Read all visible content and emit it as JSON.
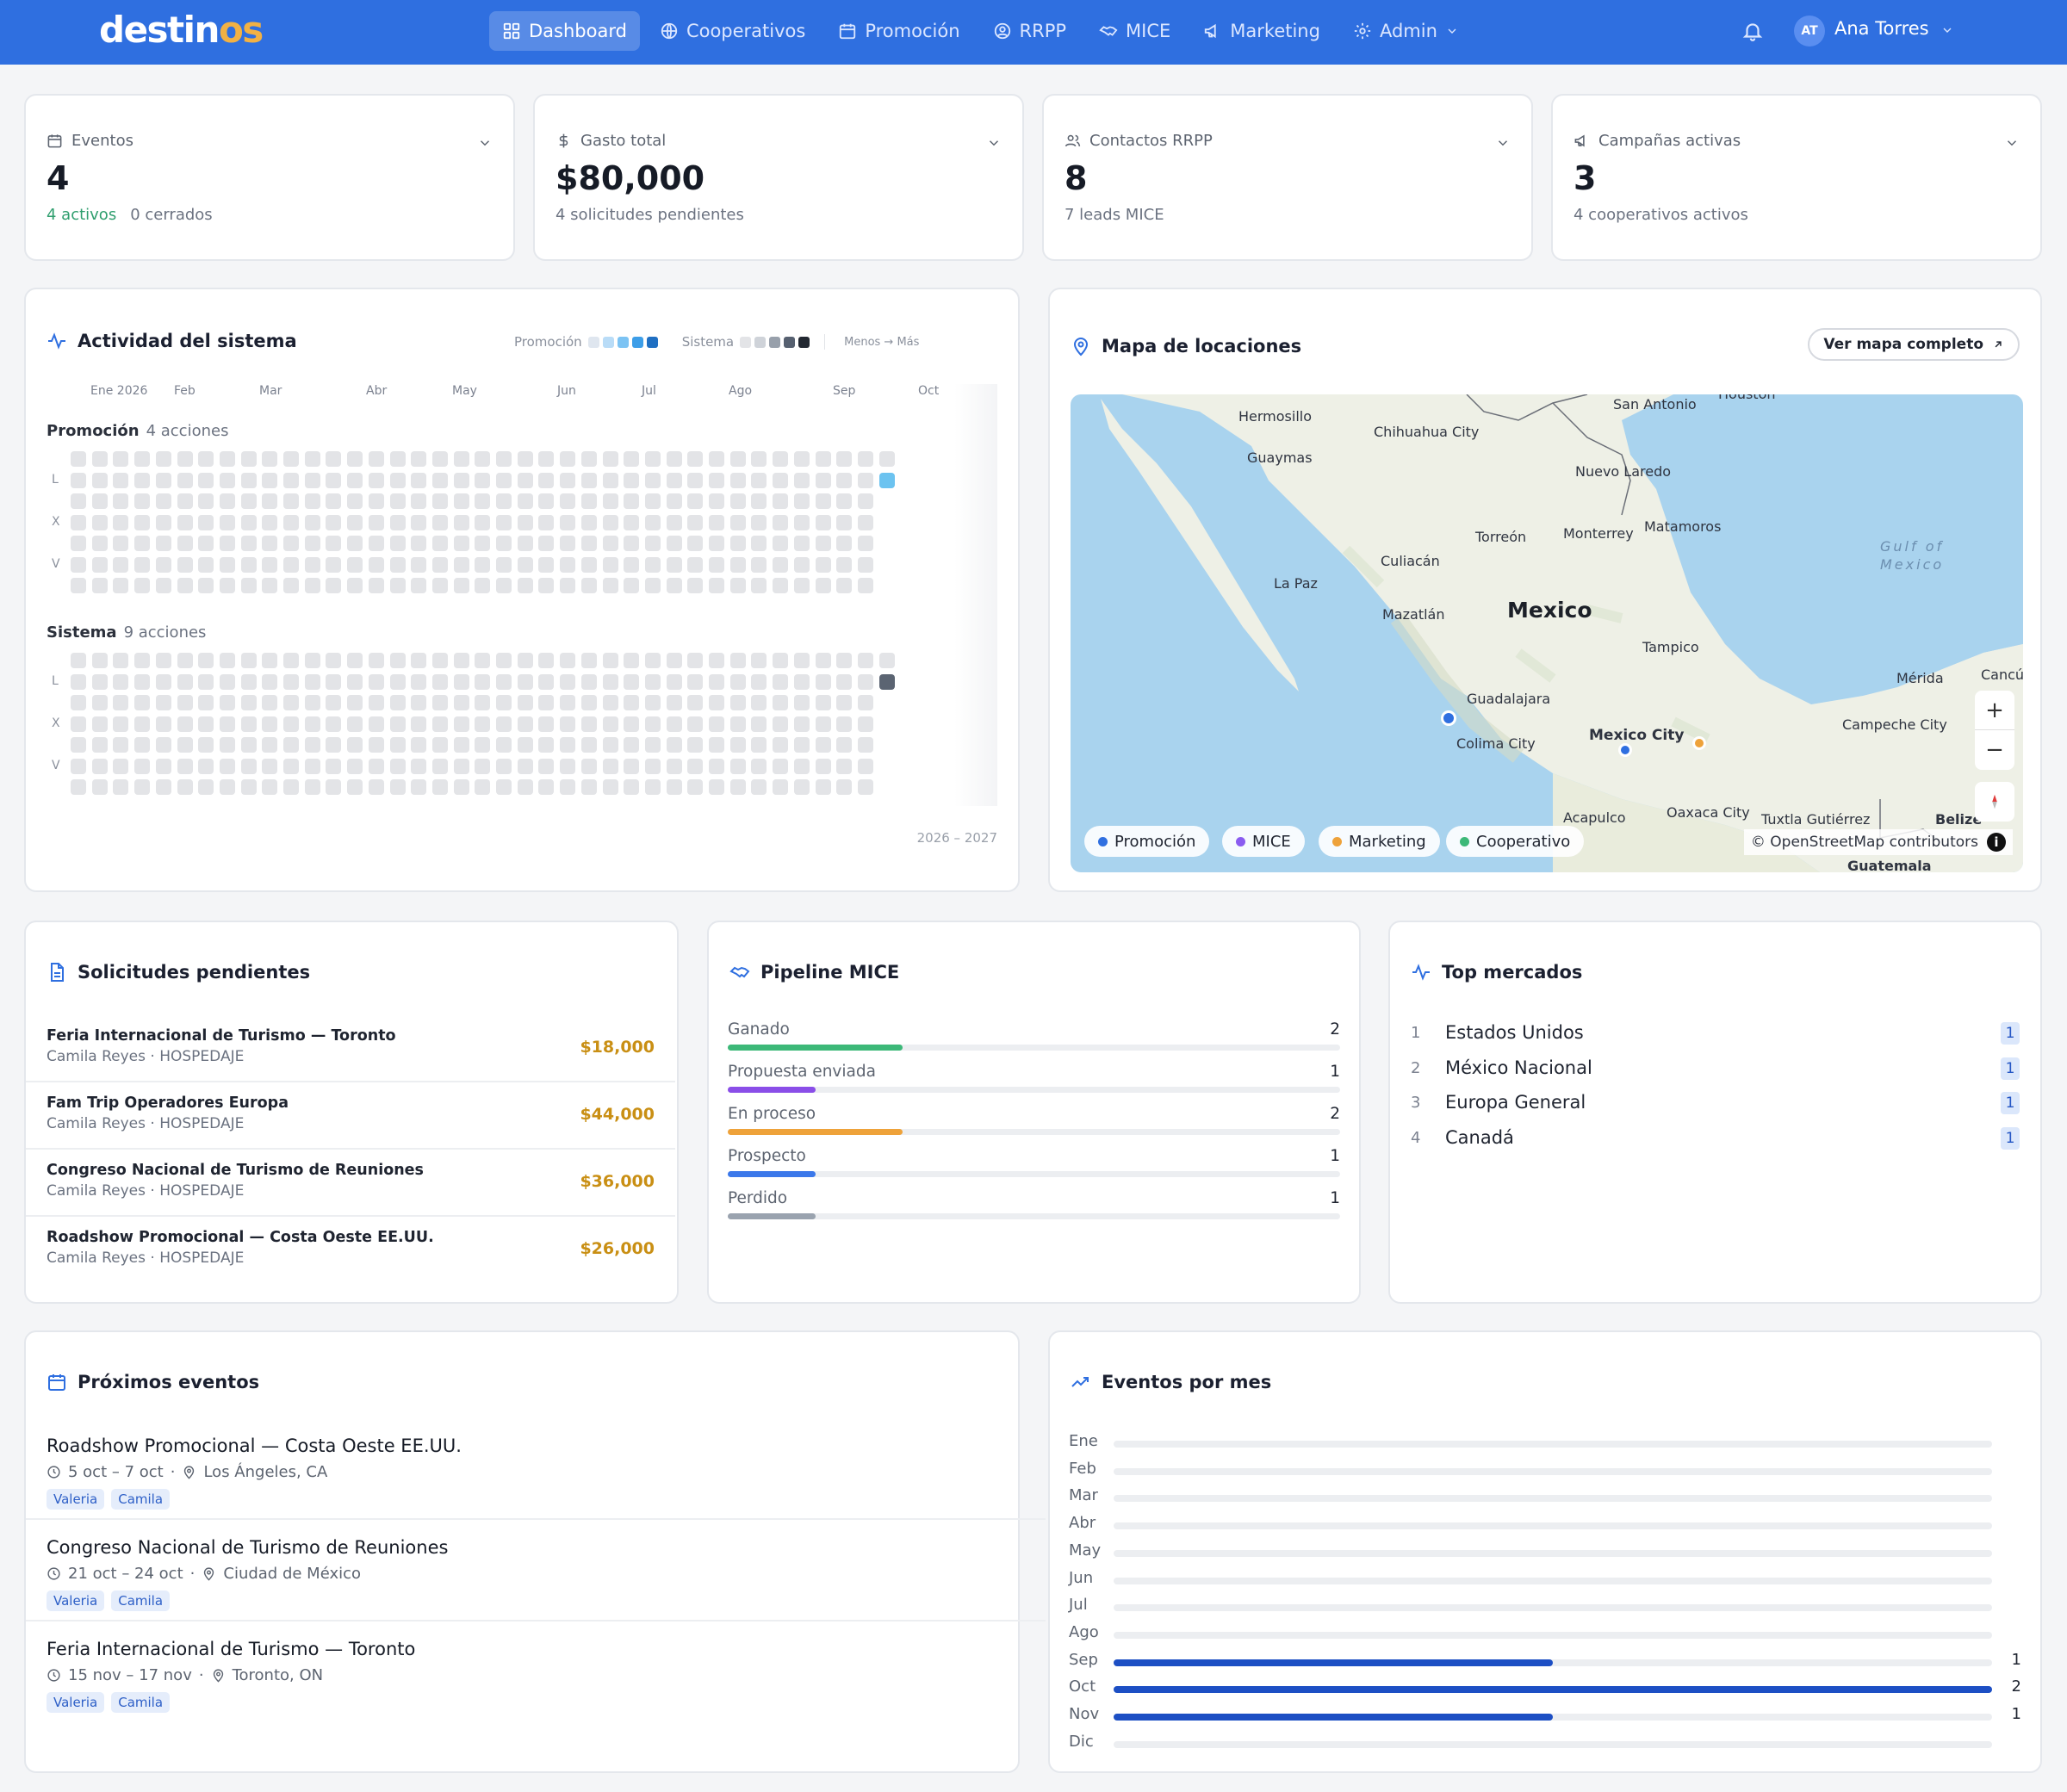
{
  "brand": {
    "logo_main": "destin",
    "logo_accent": "os"
  },
  "nav": {
    "items": [
      {
        "label": "Dashboard",
        "icon": "grid-icon",
        "active": true
      },
      {
        "label": "Cooperativos",
        "icon": "globe-icon"
      },
      {
        "label": "Promoción",
        "icon": "calendar-icon"
      },
      {
        "label": "RRPP",
        "icon": "user-circle-icon"
      },
      {
        "label": "MICE",
        "icon": "handshake-icon"
      },
      {
        "label": "Marketing",
        "icon": "megaphone-icon"
      },
      {
        "label": "Admin",
        "icon": "gear-icon"
      }
    ],
    "user_initials": "AT",
    "user_name": "Ana Torres"
  },
  "stats": [
    {
      "label": "Eventos",
      "icon": "calendar-icon",
      "value": "4",
      "sub_green": "4 activos",
      "sub": "0 cerrados"
    },
    {
      "label": "Gasto total",
      "icon": "dollar-icon",
      "value": "$80,000",
      "sub": "4 solicitudes pendientes"
    },
    {
      "label": "Contactos RRPP",
      "icon": "users-icon",
      "value": "8",
      "sub": "7 leads MICE"
    },
    {
      "label": "Campañas activas",
      "icon": "megaphone-icon",
      "value": "3",
      "sub": "4 cooperativos activos"
    }
  ],
  "activity": {
    "title": "Actividad del sistema",
    "legend_promo": "Promoción",
    "legend_sistema": "Sistema",
    "legend_scale": "Menos → Más",
    "promo_colors": [
      "#dfe6ef",
      "#b9dcf7",
      "#7cc3f3",
      "#3d9ee8",
      "#1f6fc2"
    ],
    "sistema_colors": [
      "#e3e4e7",
      "#cfd3d9",
      "#98a0ab",
      "#566070",
      "#222831"
    ],
    "months": [
      "Ene 2026",
      "Feb",
      "Mar",
      "Abr",
      "May",
      "Jun",
      "Jul",
      "Ago",
      "Sep",
      "Oct"
    ],
    "day_labels": [
      "L",
      "X",
      "V"
    ],
    "promo_title": "Promoción",
    "promo_count": "4 acciones",
    "promo_highlight_color": "#6cc3f0",
    "sistema_title": "Sistema",
    "sistema_count": "9 acciones",
    "sistema_highlight_color": "#5b6472",
    "range": "2026 – 2027"
  },
  "map": {
    "title": "Mapa de locaciones",
    "button": "Ver mapa completo",
    "country": "Mexico",
    "gulf_line1": "Gulf of",
    "gulf_line2": "Mexico",
    "cities": [
      "Hermosillo",
      "Chihuahua City",
      "San Antonio",
      "Houston",
      "Guaymas",
      "Nuevo Laredo",
      "Torreón",
      "Monterrey",
      "Matamoros",
      "Culiacán",
      "La Paz",
      "Mazatlán",
      "Tampico",
      "Mérida",
      "Cancú",
      "Guadalajara",
      "Campeche City",
      "Colima City",
      "Mexico City",
      "Acapulco",
      "Oaxaca City",
      "Tuxtla Gutiérrez",
      "Belize",
      "Guatemala"
    ],
    "legend": [
      {
        "label": "Promoción",
        "color": "#2f6fe0"
      },
      {
        "label": "MICE",
        "color": "#8a5cf0"
      },
      {
        "label": "Marketing",
        "color": "#eea23a"
      },
      {
        "label": "Cooperativo",
        "color": "#3cb878"
      }
    ],
    "zoom_in": "+",
    "zoom_out": "−",
    "attribution": "© OpenStreetMap contributors",
    "info": "i"
  },
  "requests": {
    "title": "Solicitudes pendientes",
    "items": [
      {
        "title": "Feria Internacional de Turismo — Toronto",
        "sub": "Camila Reyes · HOSPEDAJE",
        "amount": "$18,000"
      },
      {
        "title": "Fam Trip Operadores Europa",
        "sub": "Camila Reyes · HOSPEDAJE",
        "amount": "$44,000"
      },
      {
        "title": "Congreso Nacional de Turismo de Reuniones",
        "sub": "Camila Reyes · HOSPEDAJE",
        "amount": "$36,000"
      },
      {
        "title": "Roadshow Promocional — Costa Oeste EE.UU.",
        "sub": "Camila Reyes · HOSPEDAJE",
        "amount": "$26,000"
      }
    ]
  },
  "pipeline": {
    "title": "Pipeline MICE",
    "max": 7,
    "stages": [
      {
        "label": "Ganado",
        "value": 2,
        "color": "#3cb878"
      },
      {
        "label": "Propuesta enviada",
        "value": 1,
        "color": "#8a4ee8"
      },
      {
        "label": "En proceso",
        "value": 2,
        "color": "#eea23a"
      },
      {
        "label": "Prospecto",
        "value": 1,
        "color": "#3b78ea"
      },
      {
        "label": "Perdido",
        "value": 1,
        "color": "#9aa3af"
      }
    ]
  },
  "markets": {
    "title": "Top mercados",
    "items": [
      {
        "rank": "1",
        "name": "Estados Unidos",
        "count": "1"
      },
      {
        "rank": "2",
        "name": "México Nacional",
        "count": "1"
      },
      {
        "rank": "3",
        "name": "Europa General",
        "count": "1"
      },
      {
        "rank": "4",
        "name": "Canadá",
        "count": "1"
      }
    ]
  },
  "upcoming": {
    "title": "Próximos eventos",
    "items": [
      {
        "title": "Roadshow Promocional — Costa Oeste EE.UU.",
        "dates": "5 oct – 7 oct",
        "place": "Los Ángeles, CA",
        "tags": [
          "Valeria",
          "Camila"
        ]
      },
      {
        "title": "Congreso Nacional de Turismo de Reuniones",
        "dates": "21 oct – 24 oct",
        "place": "Ciudad de México",
        "tags": [
          "Valeria",
          "Camila"
        ]
      },
      {
        "title": "Feria Internacional de Turismo — Toronto",
        "dates": "15 nov – 17 nov",
        "place": "Toronto, ON",
        "tags": [
          "Valeria",
          "Camila"
        ]
      }
    ]
  },
  "chart_data": {
    "type": "bar",
    "title": "Eventos por mes",
    "categories": [
      "Ene",
      "Feb",
      "Mar",
      "Abr",
      "May",
      "Jun",
      "Jul",
      "Ago",
      "Sep",
      "Oct",
      "Nov",
      "Dic"
    ],
    "values": [
      0,
      0,
      0,
      0,
      0,
      0,
      0,
      0,
      1,
      2,
      1,
      0
    ],
    "ylim": [
      0,
      2
    ],
    "orientation": "horizontal",
    "color": "#1d4fc4"
  }
}
